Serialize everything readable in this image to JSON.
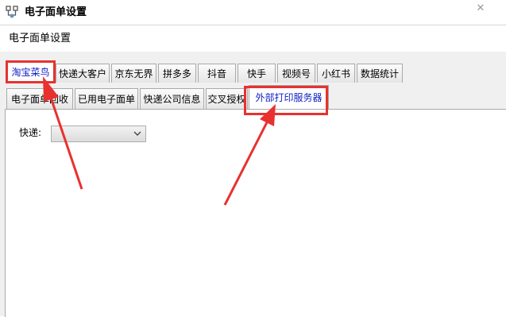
{
  "window": {
    "title": "电子面单设置",
    "close_glyph": "✕"
  },
  "header": {
    "label": "电子面单设置"
  },
  "main_tabs": [
    {
      "label": "淘宝菜鸟",
      "active": true
    },
    {
      "label": "快递大客户"
    },
    {
      "label": "京东无界"
    },
    {
      "label": "拼多多"
    },
    {
      "label": "抖音"
    },
    {
      "label": "快手"
    },
    {
      "label": "视频号"
    },
    {
      "label": "小红书"
    },
    {
      "label": "数据统计"
    }
  ],
  "sub_tabs": [
    {
      "label": "电子面单回收"
    },
    {
      "label": "已用电子面单"
    },
    {
      "label": "快递公司信息"
    },
    {
      "label": "交叉授权"
    },
    {
      "label": "外部打印服务器",
      "active": true
    }
  ],
  "form": {
    "courier_label": "快递:",
    "courier_value": ""
  },
  "colors": {
    "highlight": "#e8312f",
    "active_tab_text": "#0b1cc4"
  }
}
